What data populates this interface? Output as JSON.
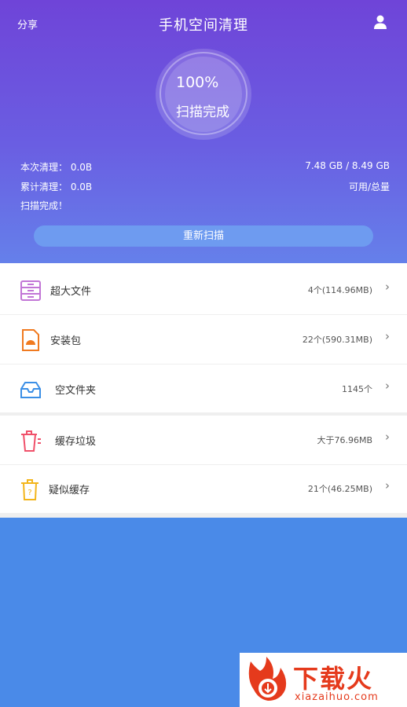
{
  "header": {
    "share_label": "分享",
    "title": "手机空间清理",
    "percent": "100%",
    "scan_status": "扫描完成",
    "this_clean": "本次清理： 0.0B",
    "total_clean": "累计清理： 0.0B",
    "scan_complete": "扫描完成！",
    "storage": "7.48 GB / 8.49 GB",
    "storage_label": "可用/总量",
    "rescan_label": "重新扫描"
  },
  "rows": [
    {
      "label": "超大文件",
      "value": "4个(114.96MB)",
      "icon": "file-cabinet-icon"
    },
    {
      "label": "安装包",
      "value": "22个(590.31MB)",
      "icon": "package-icon"
    },
    {
      "label": "空文件夹",
      "value": "1145个",
      "icon": "empty-folder-icon"
    },
    {
      "label": "缓存垃圾",
      "value": "大于76.96MB",
      "icon": "trash-icon"
    },
    {
      "label": "疑似缓存",
      "value": "21个(46.25MB)",
      "icon": "suspect-cache-icon"
    }
  ],
  "watermark": {
    "brand": "下载火",
    "domain": "xiazaihuo.com"
  },
  "colors": {
    "header_top": "#6f44d8",
    "header_bottom": "#6580ea",
    "page_bg": "#4a8ae8",
    "rescan_button": "#6e9bf0"
  }
}
